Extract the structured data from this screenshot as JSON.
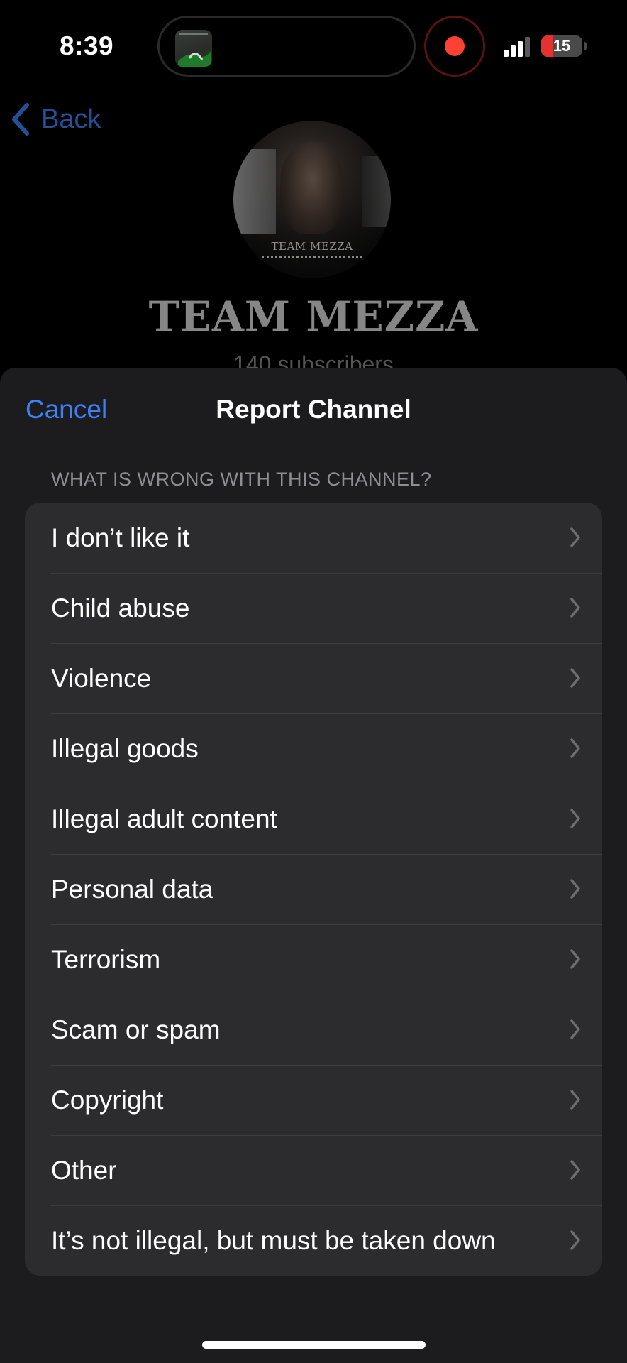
{
  "status_bar": {
    "time": "8:39",
    "battery_level": "15",
    "battery_fraction": 0.15,
    "recording": true,
    "rec_color": "#ff4134"
  },
  "background_page": {
    "back_label": "Back",
    "avatar_text": "TEAM MEZZA",
    "channel_name": "TEAM MEZZA",
    "subscribers": "140 subscribers"
  },
  "sheet": {
    "cancel_label": "Cancel",
    "title": "Report Channel",
    "section_label": "WHAT IS WRONG WITH THIS CHANNEL?",
    "options": [
      {
        "label": "I don’t like it"
      },
      {
        "label": "Child abuse"
      },
      {
        "label": "Violence"
      },
      {
        "label": "Illegal goods"
      },
      {
        "label": "Illegal adult content"
      },
      {
        "label": "Personal data"
      },
      {
        "label": "Terrorism"
      },
      {
        "label": "Scam or spam"
      },
      {
        "label": "Copyright"
      },
      {
        "label": "Other"
      },
      {
        "label": "It’s not illegal, but must be taken down"
      }
    ]
  },
  "colors": {
    "accent": "#3b82f6",
    "sheet_bg": "#1c1c1e",
    "row_bg": "#2c2c2e",
    "secondary_text": "#8d8d93"
  }
}
